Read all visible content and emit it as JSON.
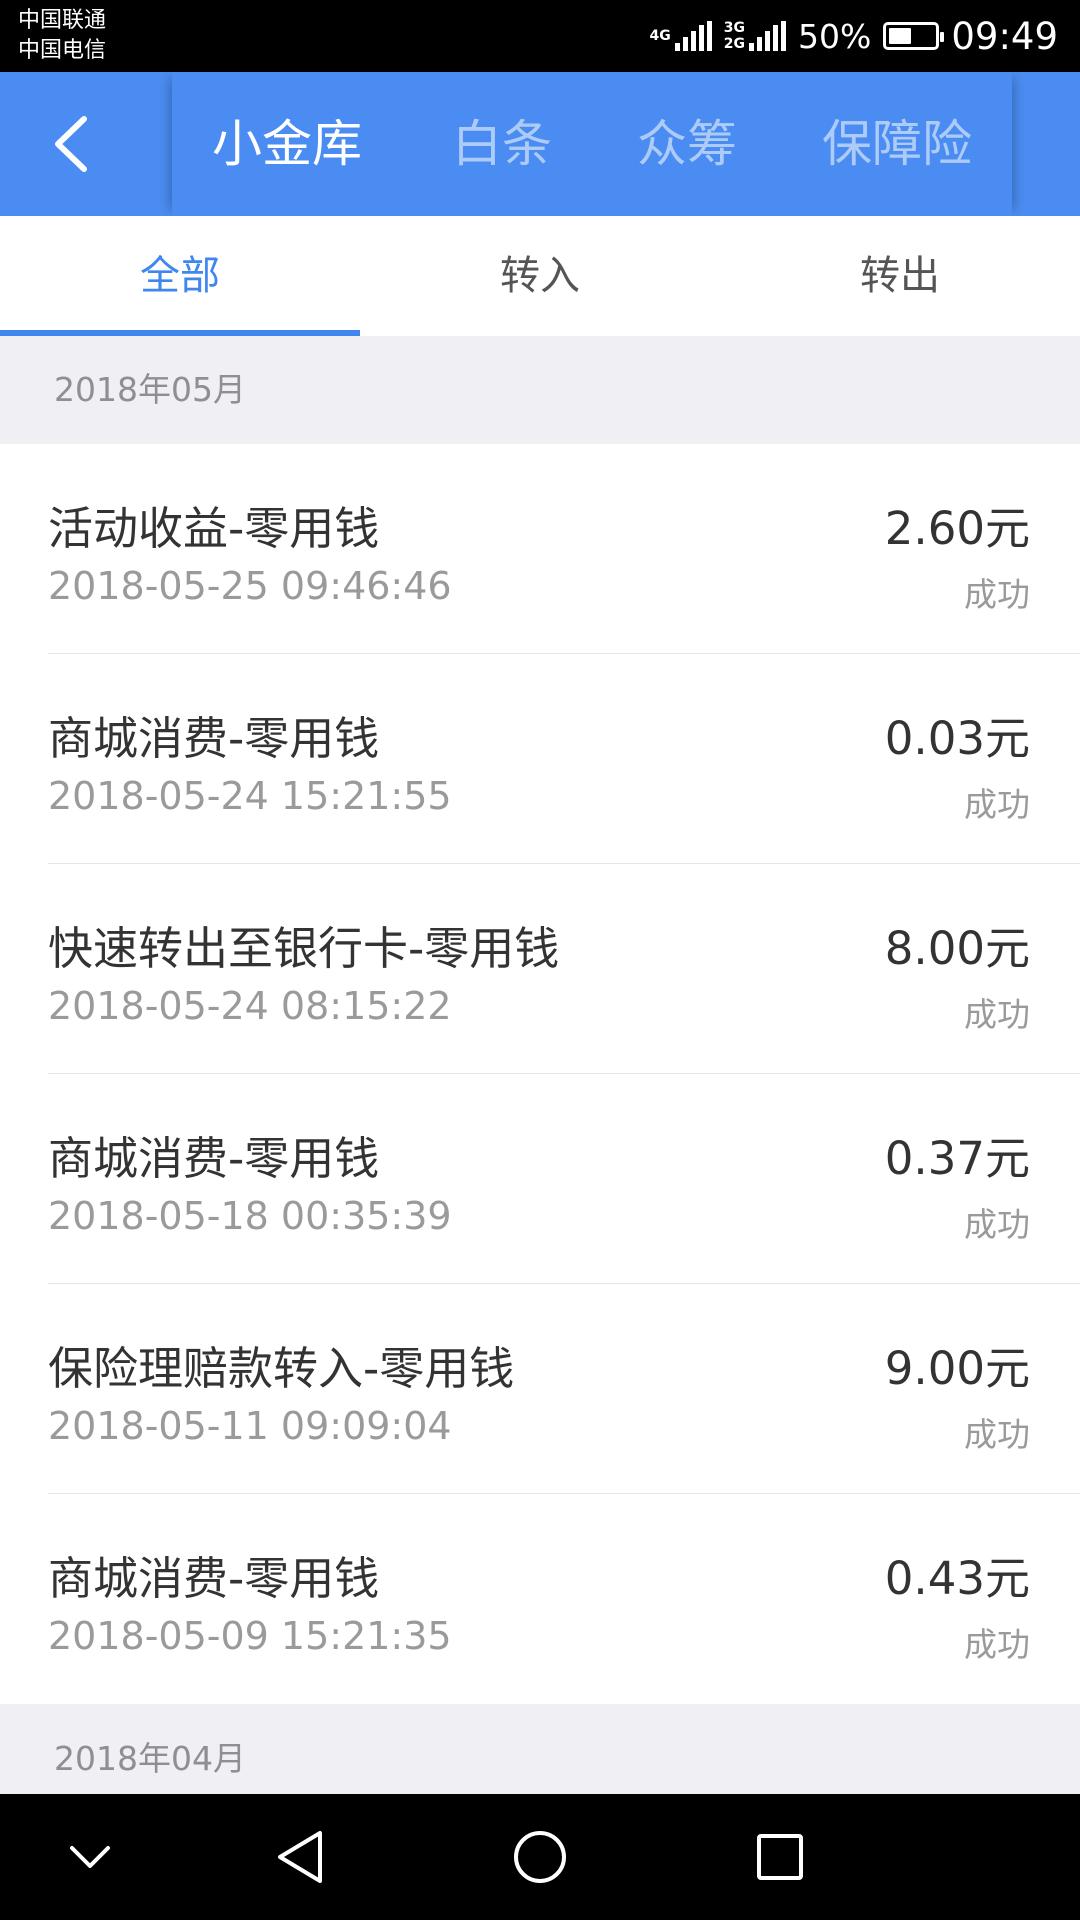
{
  "status_bar": {
    "carrier_1": "中国联通",
    "carrier_2": "中国电信",
    "network_1": "4G",
    "network_2_top": "3G",
    "network_2_bottom": "2G",
    "battery_percent": "50%",
    "battery_level": 0.5,
    "time": "09:49"
  },
  "header": {
    "back_icon": "chevron-left-icon",
    "tabs": [
      {
        "label": "小金库",
        "active": true
      },
      {
        "label": "白条",
        "active": false
      },
      {
        "label": "众筹",
        "active": false
      },
      {
        "label": "保障险",
        "active": false
      }
    ]
  },
  "sub_tabs": [
    {
      "label": "全部",
      "active": true
    },
    {
      "label": "转入",
      "active": false
    },
    {
      "label": "转出",
      "active": false
    }
  ],
  "groups": [
    {
      "month": "2018年05月",
      "items": [
        {
          "title": "活动收益-零用钱",
          "time": "2018-05-25 09:46:46",
          "amount": "2.60元",
          "status": "成功"
        },
        {
          "title": "商城消费-零用钱",
          "time": "2018-05-24 15:21:55",
          "amount": "0.03元",
          "status": "成功"
        },
        {
          "title": "快速转出至银行卡-零用钱",
          "time": "2018-05-24 08:15:22",
          "amount": "8.00元",
          "status": "成功"
        },
        {
          "title": "商城消费-零用钱",
          "time": "2018-05-18 00:35:39",
          "amount": "0.37元",
          "status": "成功"
        },
        {
          "title": "保险理赔款转入-零用钱",
          "time": "2018-05-11 09:09:04",
          "amount": "9.00元",
          "status": "成功"
        },
        {
          "title": "商城消费-零用钱",
          "time": "2018-05-09 15:21:35",
          "amount": "0.43元",
          "status": "成功"
        }
      ]
    },
    {
      "month": "2018年04月",
      "items": []
    }
  ],
  "nav_bar": {
    "icons": [
      "chevron-down-icon",
      "back-triangle-icon",
      "home-circle-icon",
      "recents-square-icon"
    ]
  },
  "colors": {
    "accent": "#3f86ee",
    "header_bg": "#4a8cf1",
    "section_bg": "#f0f0f4"
  }
}
